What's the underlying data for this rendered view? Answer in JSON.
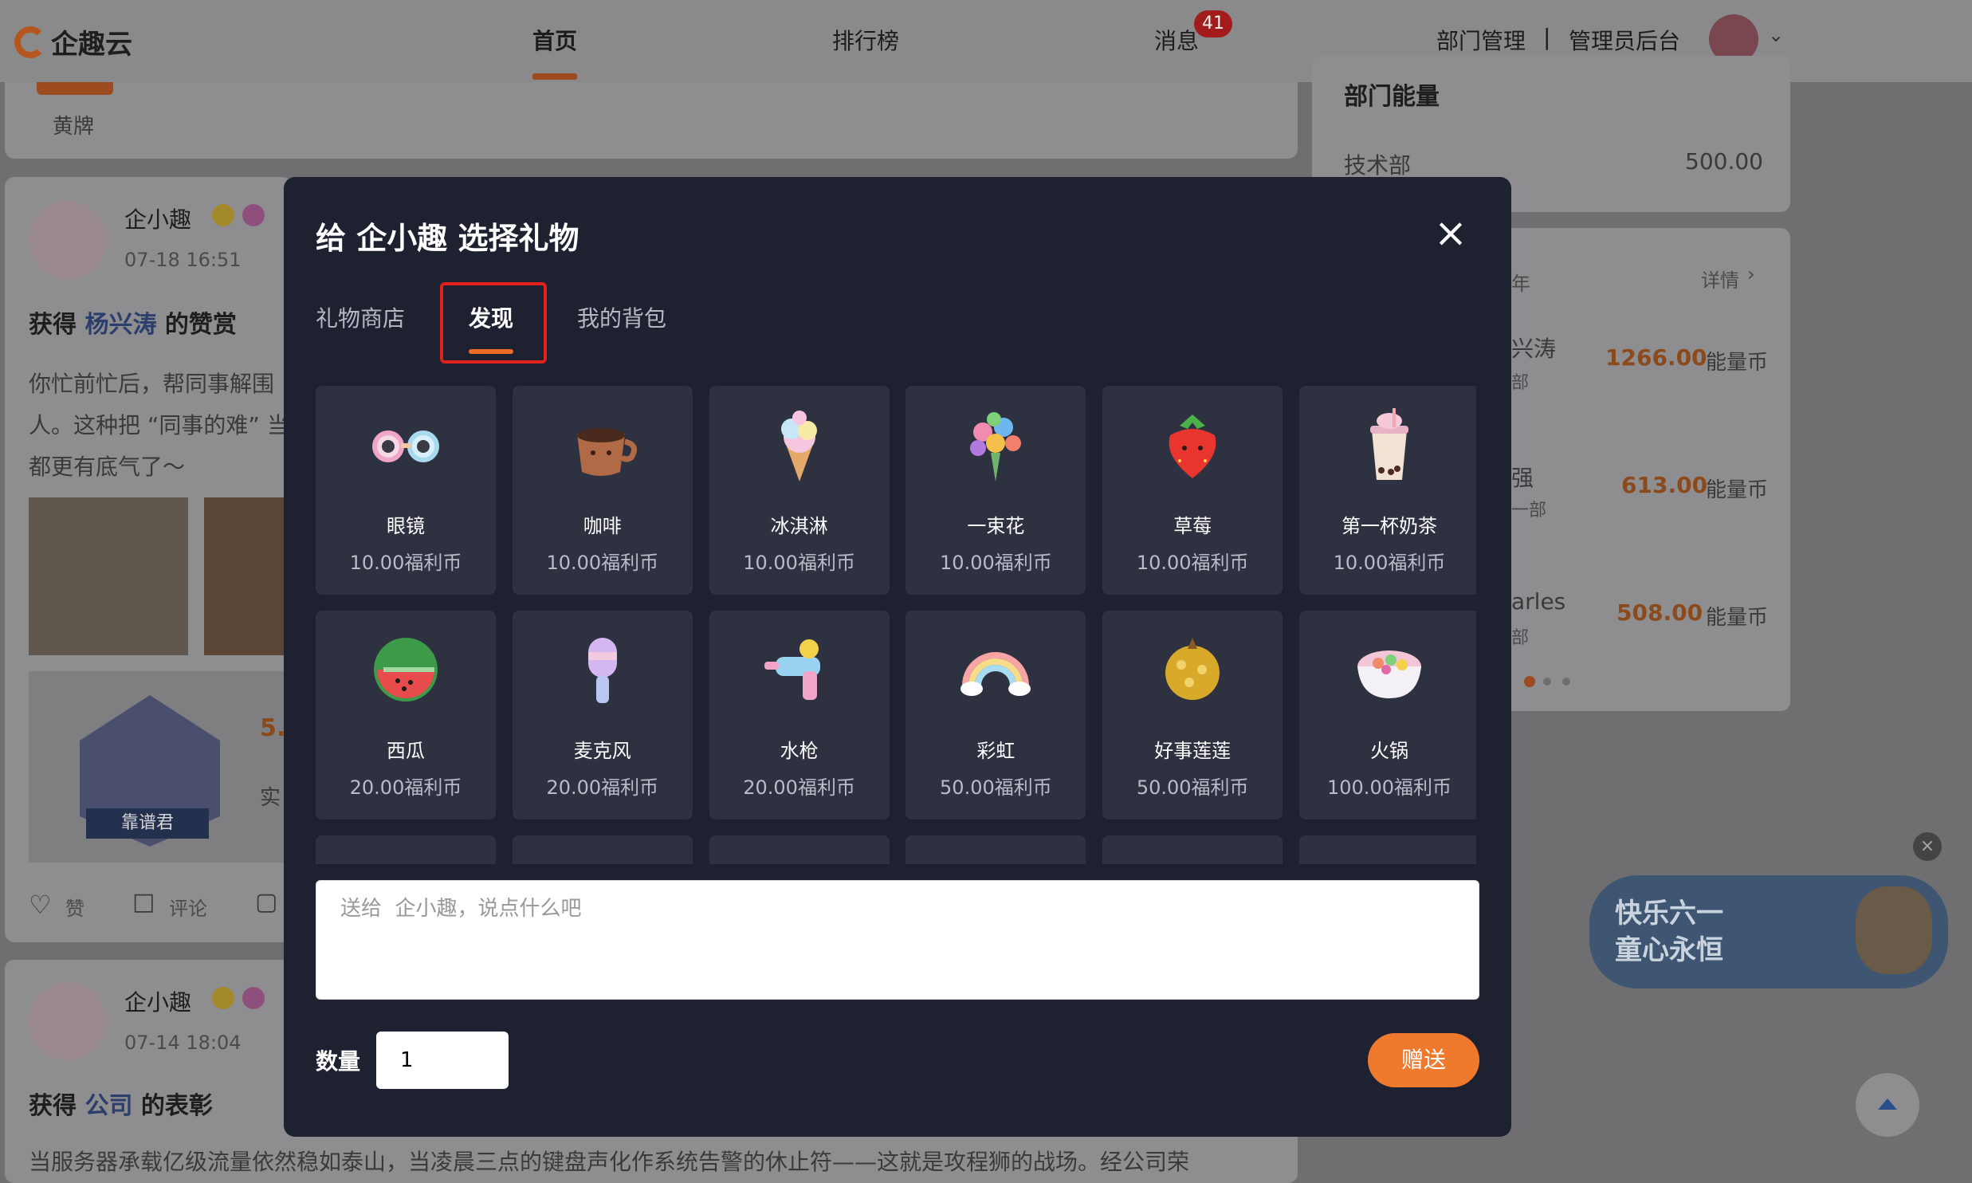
{
  "header": {
    "logo_text": "企趣云",
    "nav": [
      {
        "label": "首页"
      },
      {
        "label": "排行榜"
      },
      {
        "label": "消息"
      }
    ],
    "message_badge": "41",
    "dept_manage": "部门管理",
    "separator": "|",
    "admin": "管理员后台"
  },
  "background": {
    "filter_active": "黄牌",
    "post1": {
      "author": "企小趣",
      "time": "07-18 16:51",
      "title_prefix": "获得",
      "title_name": "杨兴涛",
      "title_suffix": "的赞赏",
      "line1": "你忙前忙后，帮同事解围",
      "line2": "人。这种把 “同事的难” 当",
      "line3": "都更有底气了～",
      "badge_text": "靠谱君",
      "score_partial": "5.",
      "text_partial": "实",
      "like": "赞",
      "comment": "评论"
    },
    "post2": {
      "author": "企小趣",
      "time": "07-14 18:04",
      "title_prefix": "获得",
      "title_name": "公司",
      "title_suffix": "的表彰",
      "line1": "当服务器承载亿级流量依然稳如泰山，当凌晨三点的键盘声化作系统告警的休止符——这就是攻程狮的战场。经公司荣"
    },
    "right": {
      "energy_title": "部门能量",
      "dept": "技术部",
      "dept_value": "500.00",
      "rank_header_partial": "年",
      "detail": "详情",
      "rows": [
        {
          "name_partial": "兴涛",
          "sub": "部",
          "value": "1266.00",
          "unit": "能量币"
        },
        {
          "name_partial": "强",
          "sub": "一部",
          "value": "613.00",
          "unit": "能量币"
        },
        {
          "name_partial": "arles",
          "sub": "部",
          "value": "508.00",
          "unit": "能量币"
        }
      ],
      "banner_line1": "快乐六一",
      "banner_line2": "童心永恒"
    }
  },
  "modal": {
    "title": "给 企小趣 选择礼物",
    "tabs": [
      "礼物商店",
      "发现",
      "我的背包"
    ],
    "active_tab": "发现",
    "gifts": [
      {
        "name": "眼镜",
        "price": "10.00福利币",
        "icon": "glasses-icon"
      },
      {
        "name": "咖啡",
        "price": "10.00福利币",
        "icon": "coffee-icon"
      },
      {
        "name": "冰淇淋",
        "price": "10.00福利币",
        "icon": "ice-cream-icon"
      },
      {
        "name": "一束花",
        "price": "10.00福利币",
        "icon": "bouquet-icon"
      },
      {
        "name": "草莓",
        "price": "10.00福利币",
        "icon": "strawberry-icon"
      },
      {
        "name": "第一杯奶茶",
        "price": "10.00福利币",
        "icon": "milk-tea-icon"
      },
      {
        "name": "西瓜",
        "price": "20.00福利币",
        "icon": "watermelon-icon"
      },
      {
        "name": "麦克风",
        "price": "20.00福利币",
        "icon": "microphone-icon"
      },
      {
        "name": "水枪",
        "price": "20.00福利币",
        "icon": "water-gun-icon"
      },
      {
        "name": "彩虹",
        "price": "50.00福利币",
        "icon": "rainbow-icon"
      },
      {
        "name": "好事莲莲",
        "price": "50.00福利币",
        "icon": "durian-icon"
      },
      {
        "name": "火锅",
        "price": "100.00福利币",
        "icon": "hotpot-icon"
      }
    ],
    "message_placeholder": "送给  企小趣，说点什么吧",
    "quantity_label": "数量",
    "quantity_value": "1",
    "send_label": "赠送"
  }
}
